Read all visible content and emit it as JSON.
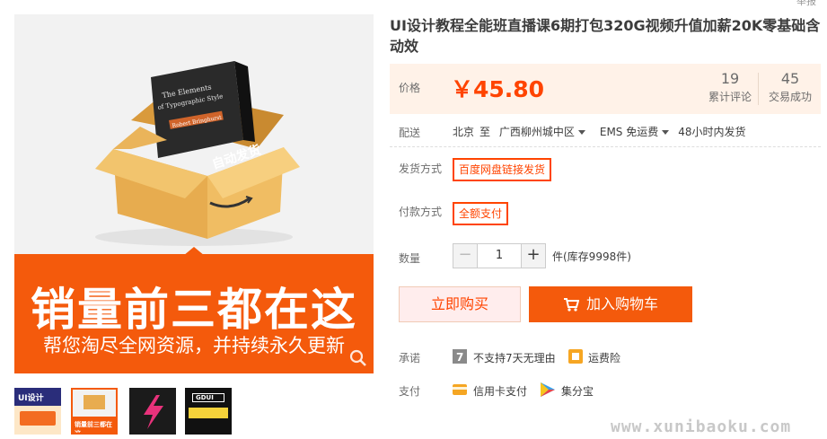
{
  "header": {
    "report_link": "举报"
  },
  "gallery": {
    "banner_main": "销量前三都在这",
    "banner_sub": "帮您淘尽全网资源，并持续永久更新",
    "box_label": "自动发货",
    "book_title_line1": "The Elements",
    "book_title_line2": "of Typographic Style",
    "book_author": "Robert Bringhurst",
    "thumbs": [
      {
        "label": "UI设计"
      },
      {
        "label": "销量前三都在这"
      },
      {
        "label": ""
      },
      {
        "label": "GDUI"
      }
    ]
  },
  "product": {
    "title": "UI设计教程全能班直播课6期打包320G视频升值加薪20K零基础含动效",
    "price_label": "价格",
    "price": "￥45.80",
    "reviews_count": "19",
    "reviews_label": "累计评论",
    "sales_count": "45",
    "sales_label": "交易成功"
  },
  "shipping": {
    "label": "配送",
    "from": "北京",
    "to_word": "至",
    "destination": "广西柳州城中区",
    "method": "EMS 免运费",
    "ship_time": "48小时内发货"
  },
  "delivery": {
    "label": "发货方式",
    "option": "百度网盘链接发货"
  },
  "payment_type": {
    "label": "付款方式",
    "option": "全额支付"
  },
  "quantity": {
    "label": "数量",
    "minus": "−",
    "value": "1",
    "plus": "+",
    "stock": "件(库存9998件)"
  },
  "actions": {
    "buy_now": "立即购买",
    "add_to_cart": "加入购物车"
  },
  "promise": {
    "label": "承诺",
    "items": [
      "不支持7天无理由",
      "运费险"
    ]
  },
  "pay": {
    "label": "支付",
    "items": [
      "信用卡支付",
      "集分宝"
    ]
  },
  "watermark": "www.xunibaoku.com",
  "colors": {
    "accent": "#f45a0c",
    "price": "#ff4400",
    "price_bg": "#fff2e8"
  }
}
